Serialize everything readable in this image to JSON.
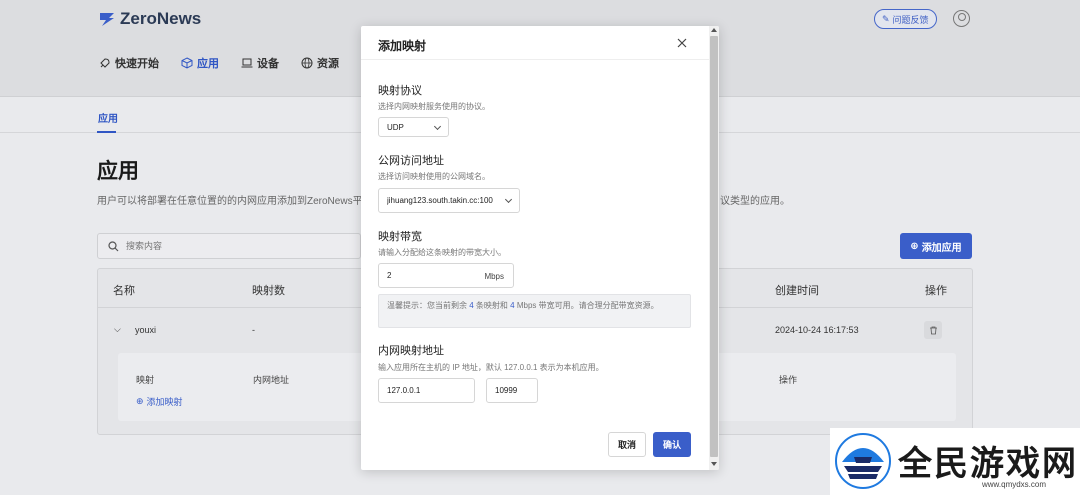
{
  "app": {
    "brand": "ZeroNews",
    "feedback_label": "问题反馈",
    "brand_color": "#3a5ec9"
  },
  "nav": {
    "items": [
      {
        "label": "快速开始",
        "icon": "rocket-icon"
      },
      {
        "label": "应用",
        "icon": "cube-icon"
      },
      {
        "label": "设备",
        "icon": "laptop-icon"
      },
      {
        "label": "资源",
        "icon": "globe-icon"
      }
    ],
    "active": "应用"
  },
  "subtab": {
    "label": "应用"
  },
  "page": {
    "title": "应用",
    "description": "用户可以将部署在任意位置的的内网应用添加到ZeroNews平",
    "description_tail": "议类型的应用。"
  },
  "search": {
    "placeholder": "搜索内容"
  },
  "add_app_button": "添加应用",
  "table": {
    "headers": [
      "名称",
      "映射数",
      "创建时间",
      "操作"
    ],
    "rows": [
      {
        "name": "youxi",
        "mappings": "-",
        "created": "2024-10-24 16:17:53"
      }
    ],
    "sub_headers": [
      "映射",
      "内网地址",
      "操作"
    ],
    "add_mapping_label": "添加映射"
  },
  "modal": {
    "title": "添加映射",
    "protocol": {
      "title": "映射协议",
      "desc": "选择内网映射服务使用的协议。",
      "value": "UDP"
    },
    "public_address": {
      "title": "公网访问地址",
      "desc": "选择访问映射使用的公网域名。",
      "value": "jihuang123.south.takin.cc:100"
    },
    "bandwidth": {
      "title": "映射带宽",
      "desc": "请输入分配给这条映射的带宽大小。",
      "value": "2",
      "unit": "Mbps",
      "tip_prefix": "温馨提示：您当前剩余",
      "tip_count": "4",
      "tip_mid": "条映射和",
      "tip_bw": "4",
      "tip_suffix": "Mbps 带宽可用。请合理分配带宽资源。"
    },
    "internal_address": {
      "title": "内网映射地址",
      "desc": "输入应用所在主机的 IP 地址，默认 127.0.0.1 表示为本机应用。",
      "ip": "127.0.0.1",
      "port": "10999"
    },
    "cancel_label": "取消",
    "confirm_label": "确认"
  },
  "watermark": {
    "text": "全民游戏网",
    "url": "www.qmydxs.com"
  }
}
